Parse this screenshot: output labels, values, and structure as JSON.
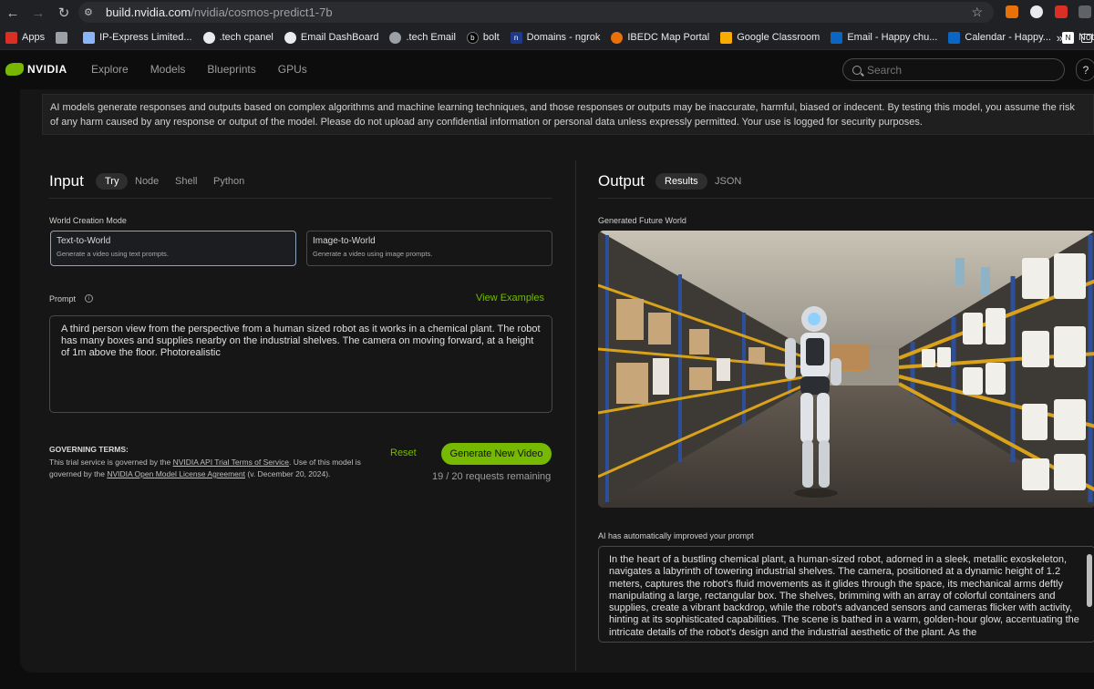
{
  "browser": {
    "url_host": "build.nvidia.com",
    "url_path": "/nvidia/cosmos-predict1-7b",
    "bookmarks": [
      {
        "label": "Apps",
        "icon": "apps-grid-icon",
        "color": "#d93025"
      },
      {
        "label": "",
        "icon": "grid-icon",
        "color": "#5f6368"
      },
      {
        "label": "IP-Express Limited...",
        "icon": "page-icon",
        "color": "#5f6368"
      },
      {
        "label": ".tech cpanel",
        "icon": "globe-icon",
        "color": "#5f6368"
      },
      {
        "label": "Email DashBoard",
        "icon": "globe-icon",
        "color": "#5f6368"
      },
      {
        "label": ".tech Email",
        "icon": "cpanel-icon",
        "color": "#5f6368"
      },
      {
        "label": "bolt",
        "icon": "bolt-icon",
        "color": "#111111"
      },
      {
        "label": "Domains - ngrok",
        "icon": "ngrok-icon",
        "color": "#1f3a8a"
      },
      {
        "label": "IBEDC Map Portal",
        "icon": "ibedc-icon",
        "color": "#e8710a"
      },
      {
        "label": "Google Classroom",
        "icon": "classroom-icon",
        "color": "#f9ab00"
      },
      {
        "label": "Email - Happy chu...",
        "icon": "outlook-icon",
        "color": "#0a66c2"
      },
      {
        "label": "Calendar - Happy...",
        "icon": "calendar-icon",
        "color": "#0a66c2"
      },
      {
        "label": "Notion",
        "icon": "notion-icon",
        "color": "#ffffff"
      }
    ],
    "more_bookmarks": "»"
  },
  "header": {
    "brand": "NVIDIA",
    "nav": [
      "Explore",
      "Models",
      "Blueprints",
      "GPUs"
    ],
    "search_placeholder": "Search",
    "help": "?"
  },
  "notice": "AI models generate responses and outputs based on complex algorithms and machine learning techniques, and those responses or outputs may be inaccurate, harmful, biased or indecent. By testing this model, you assume the risk of any harm caused by any response or output of the model. Please do not upload any confidential information or personal data unless expressly permitted. Your use is logged for security purposes.",
  "input": {
    "title": "Input",
    "tabs": [
      "Try",
      "Node",
      "Shell",
      "Python"
    ],
    "active_tab": "Try",
    "mode_label": "World Creation Mode",
    "modes": [
      {
        "title": "Text-to-World",
        "desc": "Generate a video using text prompts.",
        "selected": true
      },
      {
        "title": "Image-to-World",
        "desc": "Generate a video using image prompts.",
        "selected": false
      }
    ],
    "prompt_label": "Prompt",
    "view_examples": "View Examples",
    "prompt_text": "A third person view from the perspective from a human sized robot as it works in a chemical plant. The robot has many boxes and supplies nearby on the industrial shelves. The camera on moving forward, at a height of 1m above the floor. Photorealistic",
    "terms_title": "GOVERNING TERMS:",
    "terms_pre": "This trial service is governed by the ",
    "terms_link1": "NVIDIA API Trial Terms of Service",
    "terms_mid": ". Use of this model is governed by the ",
    "terms_link2": "NVIDIA Open Model License Agreement",
    "terms_post": " (v. December 20, 2024).",
    "reset": "Reset",
    "generate": "Generate New Video",
    "remaining": "19 / 20 requests remaining"
  },
  "output": {
    "title": "Output",
    "tabs": [
      "Results",
      "JSON"
    ],
    "active_tab": "Results",
    "generated_label": "Generated Future World",
    "improved_label": "AI has automatically improved your prompt",
    "improved_text": "In the heart of a bustling chemical plant, a human-sized robot, adorned in a sleek, metallic exoskeleton, navigates a labyrinth of towering industrial shelves. The camera, positioned at a dynamic height of 1.2 meters, captures the robot's fluid movements as it glides through the space, its mechanical arms deftly manipulating a large, rectangular box. The shelves, brimming with an array of colorful containers and supplies, create a vibrant backdrop, while the robot's advanced sensors and cameras flicker with activity, hinting at its sophisticated capabilities. The scene is bathed in a warm, golden-hour glow, accentuating the intricate details of the robot's design and the industrial aesthetic of the plant. As the"
  },
  "colors": {
    "accent": "#76b900",
    "background": "#0d0d0d",
    "panel": "#161616"
  }
}
